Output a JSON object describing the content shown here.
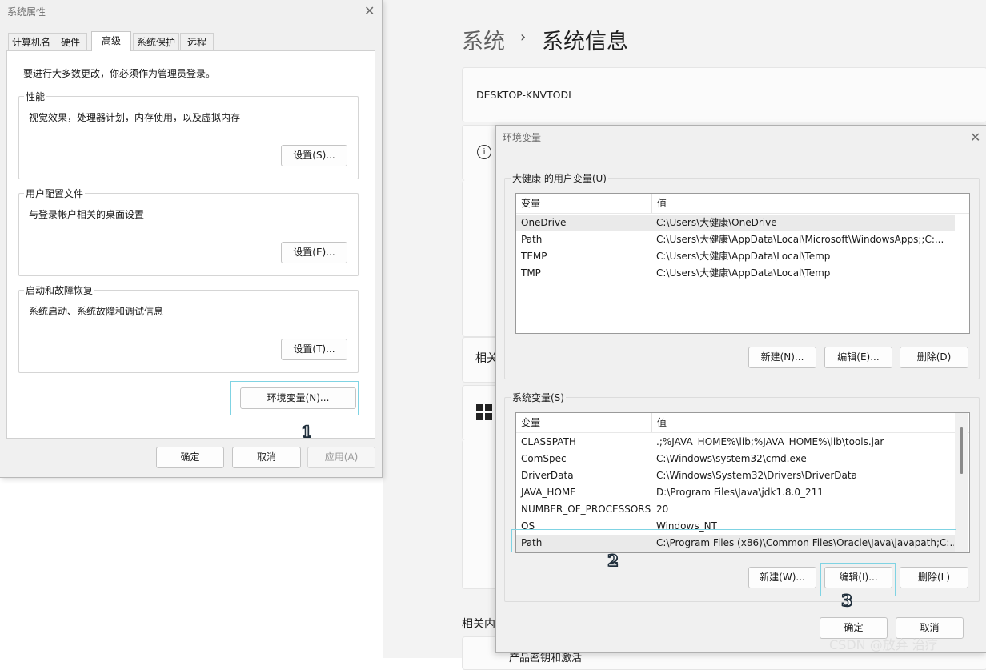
{
  "settings": {
    "breadcrumb_parent": "系统",
    "breadcrumb_separator": "›",
    "breadcrumb_current": "系统信息",
    "device_name": "DESKTOP-KNVTODI",
    "related_clip_1": "相关",
    "related_clip_2": "相关内",
    "bottom_clip": "产品密钥和激活",
    "info_icon_glyph": "i"
  },
  "system_properties": {
    "title": "系统属性",
    "tabs": [
      {
        "label": "计算机名"
      },
      {
        "label": "硬件"
      },
      {
        "label": "高级",
        "active": true
      },
      {
        "label": "系统保护"
      },
      {
        "label": "远程"
      }
    ],
    "admin_note": "要进行大多数更改，你必须作为管理员登录。",
    "performance": {
      "legend": "性能",
      "desc": "视觉效果，处理器计划，内存使用，以及虚拟内存",
      "button": "设置(S)..."
    },
    "user_profiles": {
      "legend": "用户配置文件",
      "desc": "与登录帐户相关的桌面设置",
      "button": "设置(E)..."
    },
    "startup_recovery": {
      "legend": "启动和故障恢复",
      "desc": "系统启动、系统故障和调试信息",
      "button": "设置(T)..."
    },
    "env_button": "环境变量(N)...",
    "ok": "确定",
    "cancel": "取消",
    "apply": "应用(A)"
  },
  "env_vars": {
    "title": "环境变量",
    "user_section": "大健康 的用户变量(U)",
    "columns": {
      "name": "变量",
      "value": "值"
    },
    "user_rows": [
      {
        "name": "OneDrive",
        "value": "C:\\Users\\大健康\\OneDrive",
        "selected": true
      },
      {
        "name": "Path",
        "value": "C:\\Users\\大健康\\AppData\\Local\\Microsoft\\WindowsApps;;C:..."
      },
      {
        "name": "TEMP",
        "value": "C:\\Users\\大健康\\AppData\\Local\\Temp"
      },
      {
        "name": "TMP",
        "value": "C:\\Users\\大健康\\AppData\\Local\\Temp"
      }
    ],
    "user_buttons": {
      "new": "新建(N)...",
      "edit": "编辑(E)...",
      "delete": "删除(D)"
    },
    "system_section": "系统变量(S)",
    "system_rows": [
      {
        "name": "CLASSPATH",
        "value": ".;%JAVA_HOME%\\lib;%JAVA_HOME%\\lib\\tools.jar"
      },
      {
        "name": "ComSpec",
        "value": "C:\\Windows\\system32\\cmd.exe"
      },
      {
        "name": "DriverData",
        "value": "C:\\Windows\\System32\\Drivers\\DriverData"
      },
      {
        "name": "JAVA_HOME",
        "value": "D:\\Program Files\\Java\\jdk1.8.0_211"
      },
      {
        "name": "NUMBER_OF_PROCESSORS",
        "value": "20"
      },
      {
        "name": "OS",
        "value": "Windows_NT"
      },
      {
        "name": "Path",
        "value": "C:\\Program Files (x86)\\Common Files\\Oracle\\Java\\javapath;C:...",
        "selected": true
      }
    ],
    "system_buttons": {
      "new": "新建(W)...",
      "edit": "编辑(I)...",
      "delete": "删除(L)"
    },
    "ok": "确定",
    "cancel": "取消"
  },
  "annotations": {
    "step1": "1",
    "step2": "2",
    "step3": "3"
  },
  "watermark": "CSDN @放弃    治疗",
  "colors": {
    "highlight": "#7fd3e3",
    "dialog_bg": "#f0f0f0",
    "selected_row": "#eaeaea"
  }
}
